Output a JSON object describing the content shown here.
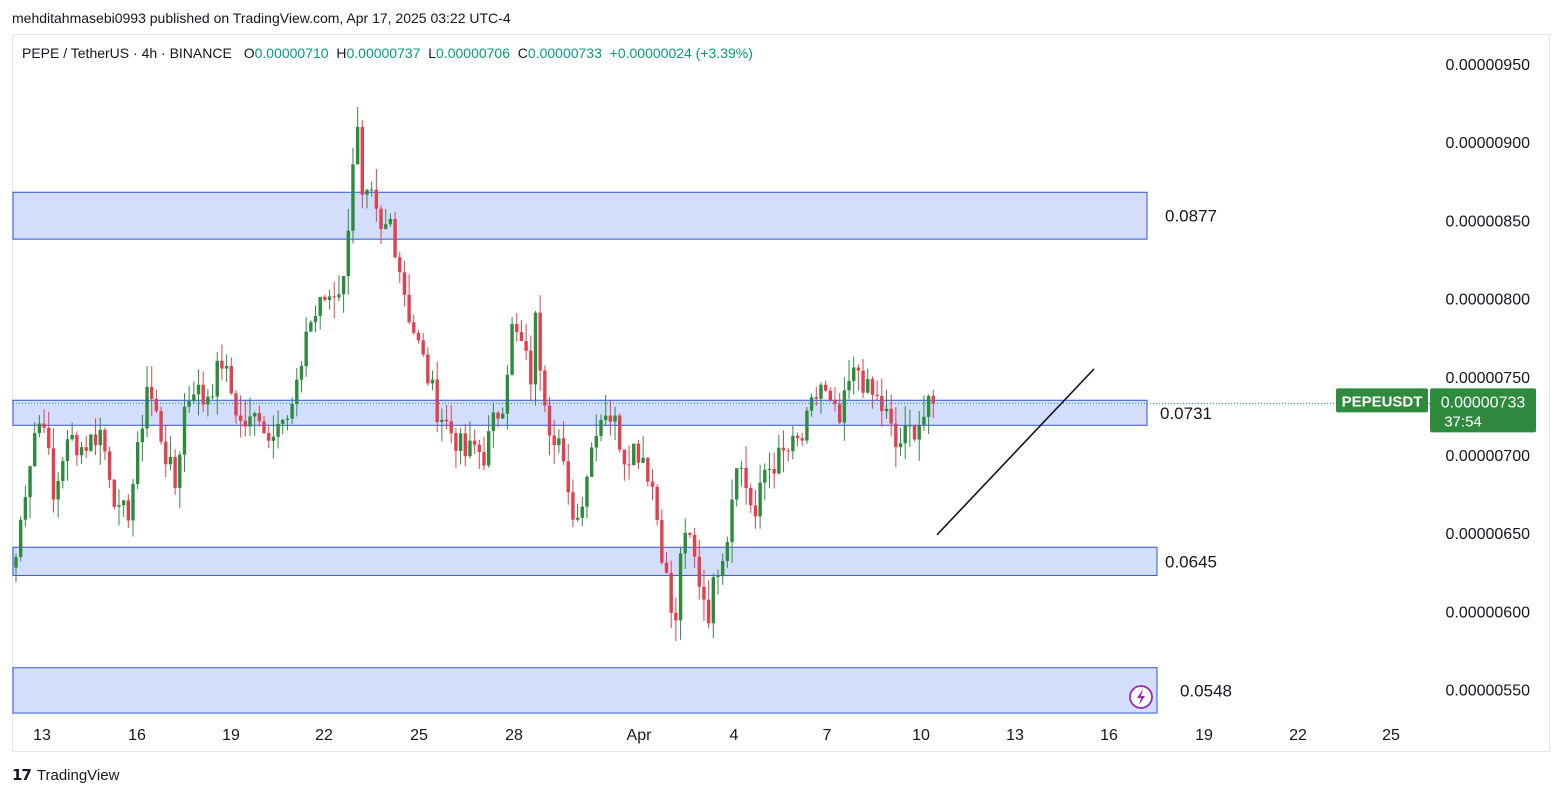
{
  "header": {
    "publisher": "mehditahmasebi0993 published on TradingView.com, Apr 17, 2025 03:22 UTC-4"
  },
  "legend": {
    "symbol": "PEPE / TetherUS · 4h · BINANCE",
    "open_key": "O",
    "open": "0.00000710",
    "high_key": "H",
    "high": "0.00000737",
    "low_key": "L",
    "low": "0.00000706",
    "close_key": "C",
    "close": "0.00000733",
    "change": "+0.00000024 (+3.39%)"
  },
  "price_tag": {
    "ticker": "PEPEUSDT",
    "price": "0.00000733",
    "countdown": "37:54"
  },
  "footer": {
    "brand": "TradingView",
    "logo": "tradingview-logo-icon"
  },
  "colors": {
    "up": "#089981",
    "down": "#f23645",
    "up_candle": "#2e8b3e",
    "down_candle": "#e0404f",
    "zone_fill": "#d3defc",
    "zone_border": "#2f55d4",
    "tag": "#2e8b3e"
  },
  "chart_data": {
    "type": "candlestick",
    "y_axis_ticks": [
      "0.00000950",
      "0.00000900",
      "0.00000850",
      "0.00000800",
      "0.00000750",
      "0.00000700",
      "0.00000650",
      "0.00000600",
      "0.00000550"
    ],
    "x_axis_ticks": [
      "13",
      "16",
      "19",
      "22",
      "25",
      "28",
      "Apr",
      "4",
      "7",
      "10",
      "13",
      "16",
      "19",
      "22",
      "25"
    ],
    "zones": [
      {
        "label": "0.0877",
        "top": 8.68e-06,
        "bottom": 8.38e-06
      },
      {
        "label": "0.0731",
        "top": 7.35e-06,
        "bottom": 7.19e-06
      },
      {
        "label": "0.0645",
        "top": 6.41e-06,
        "bottom": 6.23e-06
      },
      {
        "label": "0.0548",
        "top": 5.64e-06,
        "bottom": 5.35e-06
      }
    ],
    "trendline": {
      "from": [
        "Apr 10",
        6.49e-06
      ],
      "to": [
        "Apr 15",
        7.55e-06
      ]
    },
    "current_price": 7.33e-06,
    "anchors": [
      [
        0,
        6.35e-06
      ],
      [
        2,
        6.8e-06
      ],
      [
        4,
        7.15e-06
      ],
      [
        6,
        7.25e-06
      ],
      [
        8,
        6.7e-06
      ],
      [
        10,
        7e-06
      ],
      [
        12,
        7.1e-06
      ],
      [
        14,
        7.05e-06
      ],
      [
        16,
        7.1e-06
      ],
      [
        18,
        7.15e-06
      ],
      [
        20,
        6.9e-06
      ],
      [
        22,
        6.6e-06
      ],
      [
        24,
        6.65e-06
      ],
      [
        26,
        7e-06
      ],
      [
        28,
        7.45e-06
      ],
      [
        30,
        7.25e-06
      ],
      [
        32,
        7e-06
      ],
      [
        34,
        6.8e-06
      ],
      [
        36,
        7.3e-06
      ],
      [
        38,
        7.45e-06
      ],
      [
        40,
        7.35e-06
      ],
      [
        42,
        7.45e-06
      ],
      [
        44,
        7.6e-06
      ],
      [
        46,
        7.4e-06
      ],
      [
        48,
        7.2e-06
      ],
      [
        50,
        7.2e-06
      ],
      [
        52,
        7.28e-06
      ],
      [
        54,
        7.1e-06
      ],
      [
        56,
        7.28e-06
      ],
      [
        58,
        7.2e-06
      ],
      [
        60,
        7.4e-06
      ],
      [
        62,
        7.8e-06
      ],
      [
        64,
        7.9e-06
      ],
      [
        66,
        8e-06
      ],
      [
        68,
        8.05e-06
      ],
      [
        70,
        8.1e-06
      ],
      [
        72,
        8.9e-06
      ],
      [
        73,
        9.05e-06
      ],
      [
        74,
        8.6e-06
      ],
      [
        76,
        8.62e-06
      ],
      [
        78,
        8.4e-06
      ],
      [
        80,
        8.5e-06
      ],
      [
        82,
        8.2e-06
      ],
      [
        84,
        7.9e-06
      ],
      [
        86,
        7.7e-06
      ],
      [
        88,
        7.5e-06
      ],
      [
        90,
        7.3e-06
      ],
      [
        92,
        7.2e-06
      ],
      [
        94,
        7.1e-06
      ],
      [
        96,
        7e-06
      ],
      [
        98,
        7.05e-06
      ],
      [
        100,
        7e-06
      ],
      [
        102,
        7.2e-06
      ],
      [
        104,
        7.35e-06
      ],
      [
        106,
        7.8e-06
      ],
      [
        108,
        7.7e-06
      ],
      [
        110,
        7.5e-06
      ],
      [
        111,
        7.85e-06
      ],
      [
        112,
        7.6e-06
      ],
      [
        114,
        7.2e-06
      ],
      [
        116,
        7.1e-06
      ],
      [
        118,
        6.7e-06
      ],
      [
        120,
        6.6e-06
      ],
      [
        122,
        6.9e-06
      ],
      [
        124,
        7.2e-06
      ],
      [
        126,
        7.3e-06
      ],
      [
        128,
        7.2e-06
      ],
      [
        130,
        7e-06
      ],
      [
        132,
        7.05e-06
      ],
      [
        134,
        7e-06
      ],
      [
        136,
        6.8e-06
      ],
      [
        138,
        6.4e-06
      ],
      [
        140,
        6e-06
      ],
      [
        141,
        5.9e-06
      ],
      [
        142,
        6.4e-06
      ],
      [
        144,
        6.45e-06
      ],
      [
        146,
        6.2e-06
      ],
      [
        148,
        6e-06
      ],
      [
        150,
        6.3e-06
      ],
      [
        152,
        6.5e-06
      ],
      [
        154,
        7e-06
      ],
      [
        156,
        6.8e-06
      ],
      [
        158,
        6.6e-06
      ],
      [
        160,
        6.9e-06
      ],
      [
        162,
        6.95e-06
      ],
      [
        164,
        7e-06
      ],
      [
        166,
        7.05e-06
      ],
      [
        168,
        7.1e-06
      ],
      [
        170,
        7.3e-06
      ],
      [
        172,
        7.45e-06
      ],
      [
        174,
        7.3e-06
      ],
      [
        176,
        7.2e-06
      ],
      [
        178,
        7.45e-06
      ],
      [
        180,
        7.55e-06
      ],
      [
        182,
        7.4e-06
      ],
      [
        184,
        7.35e-06
      ],
      [
        186,
        7.25e-06
      ],
      [
        188,
        7.05e-06
      ],
      [
        190,
        7.12e-06
      ],
      [
        192,
        7.18e-06
      ],
      [
        194,
        7.25e-06
      ],
      [
        196,
        7.33e-06
      ]
    ]
  }
}
